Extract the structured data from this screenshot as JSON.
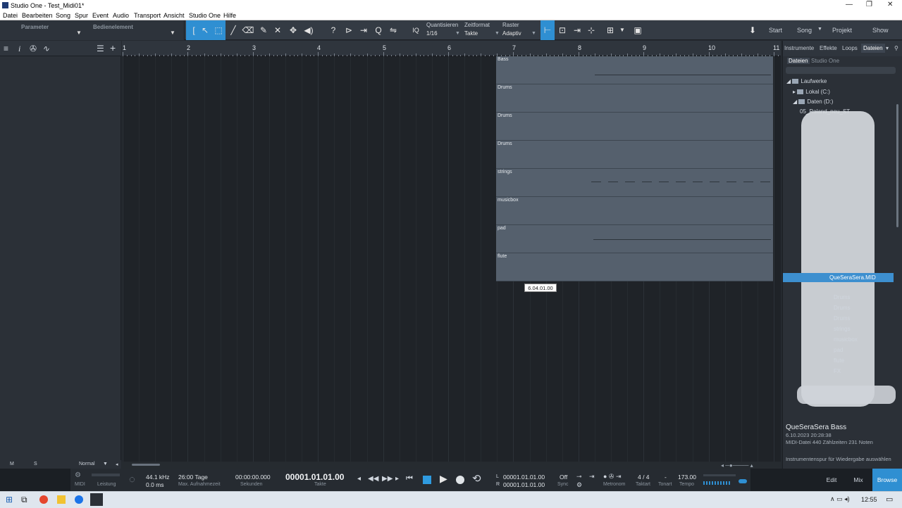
{
  "window": {
    "title": "Studio One - Test_Midi01*",
    "controls": [
      "—",
      "❐",
      "✕"
    ]
  },
  "menu": [
    "Datei",
    "Bearbeiten",
    "Song",
    "Spur",
    "Event",
    "Audio",
    "Transport",
    "Ansicht",
    "Studio One",
    "Hilfe"
  ],
  "toolbar": {
    "parameter_label": "Parameter",
    "bedienelement_label": "Bedienelement",
    "iq": "IQ",
    "quantisieren_label": "Quantisieren",
    "quantisieren_value": "1/16",
    "zeitformat_label": "Zeitformat",
    "zeitformat_value": "Takte",
    "raster_label": "Raster",
    "raster_value": "Adaptiv",
    "nav": {
      "start": "Start",
      "song": "Song",
      "projekt": "Projekt",
      "show": "Show"
    }
  },
  "ruler": {
    "bars": [
      "1",
      "2",
      "3",
      "4",
      "5",
      "6",
      "7",
      "8",
      "9",
      "10",
      "11"
    ]
  },
  "clips": [
    {
      "name": "Bass"
    },
    {
      "name": "Drums"
    },
    {
      "name": "Drums"
    },
    {
      "name": "Drums"
    },
    {
      "name": "strings"
    },
    {
      "name": "musicbox"
    },
    {
      "name": "pad"
    },
    {
      "name": "flute"
    }
  ],
  "tooltip": "6.04.01.00",
  "track_footer": {
    "m": "M",
    "s": "S",
    "mode": "Normal"
  },
  "browser": {
    "tabs": [
      "Instrumente",
      "Effekte",
      "Loops",
      "Dateien"
    ],
    "active_tab": "Dateien",
    "subtabs": [
      "Dateien",
      "Studio One"
    ],
    "tree": {
      "root": "Laufwerke",
      "drive_c": "Lokal (C:)",
      "drive_d": "Daten (D:)",
      "item_roland": "05_Roland_neu_ST",
      "item_quesera_mid": "QueSeraSera.MID",
      "files": [
        "Bass",
        "Drums",
        "Drums",
        "Drums",
        "strings",
        "musicbox",
        "pad",
        "flute",
        "FX"
      ]
    },
    "selected_title": "QueSeraSera Bass",
    "selected_date": "6.10.2023 20:28:38",
    "selected_meta": "MIDI-Datei   440 Zählzeiten   231 Noten",
    "hint": "Instrumentenspur für Wiedergabe auswählen"
  },
  "transport": {
    "midi": "MIDI",
    "leistung": "Leistung",
    "sample_rate": "44.1 kHz",
    "latency": "0.0 ms",
    "max_rec": "26:00 Tage",
    "max_rec_label": "Max. Aufnahmezeit",
    "seconds": "00:00:00.000",
    "seconds_label": "Sekunden",
    "position": "00001.01.01.00",
    "position_label": "Takte",
    "loop_l": "00001.01.01.00",
    "loop_r": "00001.01.01.00",
    "sync_value": "Off",
    "sync_label": "Sync",
    "metronom_label": "Metronom",
    "taktart_value": "4 / 4",
    "taktart_label": "Taktart",
    "tonart_value": "-",
    "tonart_label": "Tonart",
    "tempo_value": "173.00",
    "tempo_label": "Tempo",
    "views": {
      "edit": "Edit",
      "mix": "Mix",
      "browse": "Browse"
    }
  },
  "taskbar": {
    "time": "12:55"
  }
}
